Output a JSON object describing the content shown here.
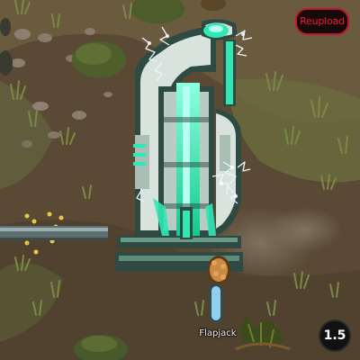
{
  "overlay": {
    "reupload_label": "Reupload",
    "speed_value": "1.5",
    "accent_color": "#f01c34"
  },
  "pawn": {
    "name": "Flapjack"
  },
  "palette": {
    "dirt": "#5a4a35",
    "grass": "#6b7a3c",
    "building_body": "#d7e3dc",
    "building_glow": "#2fe8b4",
    "building_shadow": "#2e4a42"
  }
}
